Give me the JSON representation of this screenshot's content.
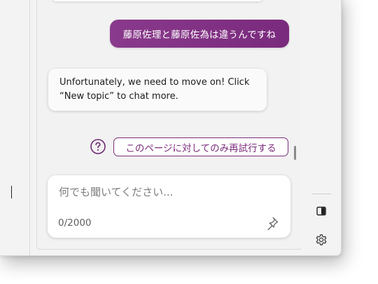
{
  "conversation": {
    "user_message": "藤原佐理と藤原佐為は違うんですね",
    "bot_message_line1": "Unfortunately, we need to move on! Click",
    "bot_message_line2": "“New topic” to chat more.",
    "retry_label": "このページに対してのみ再試行する"
  },
  "composer": {
    "placeholder": "何でも聞いてください...",
    "char_counter": "0/2000"
  },
  "colors": {
    "accent": "#7b2e7d",
    "user_bubble": "#8a3a8c",
    "panel_background": "#f2f2f2"
  },
  "icons": {
    "help": "question-circle-icon",
    "pin": "pin-icon",
    "sidebar_toggle": "sidebar-half-icon",
    "settings": "gear-icon"
  }
}
